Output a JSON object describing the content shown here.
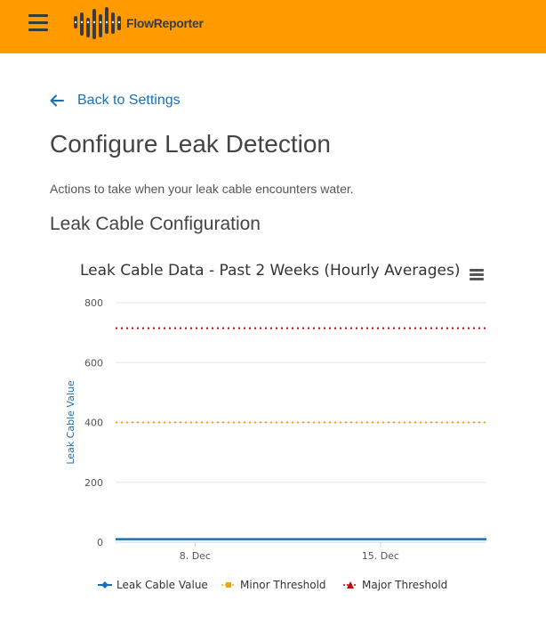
{
  "header": {
    "logo_brand": "Flow",
    "logo_brand_suffix": "Reporter",
    "colors": {
      "bar": "#ff9a00",
      "accent": "#1a6fb5"
    }
  },
  "back_link": {
    "label": "Back to Settings",
    "icon": "arrow-left-icon"
  },
  "page": {
    "title": "Configure Leak Detection",
    "description": "Actions to take when your leak cable encounters water.",
    "section_title": "Leak Cable Configuration"
  },
  "chart_data": {
    "type": "line",
    "title": "Leak Cable Data - Past 2 Weeks (Hourly Averages)",
    "ylabel": "Leak Cable Value",
    "xlabel": "",
    "ylim": [
      0,
      800
    ],
    "y_ticks": [
      "0",
      "200",
      "400",
      "600",
      "800"
    ],
    "x_ticks": [
      "8. Dec",
      "15. Dec"
    ],
    "x_range": [
      "2019-12-05",
      "2019-12-19"
    ],
    "legend_position": "bottom",
    "series": [
      {
        "name": "Leak Cable Value",
        "color": "#1a6fb5",
        "style": "solid",
        "x": [
          "2019-12-05",
          "2019-12-19"
        ],
        "values": [
          10,
          10
        ]
      },
      {
        "name": "Minor Threshold",
        "color": "#f0a800",
        "style": "dotted",
        "x": [
          "2019-12-05",
          "2019-12-19"
        ],
        "values": [
          400,
          400
        ]
      },
      {
        "name": "Major Threshold",
        "color": "#d00000",
        "style": "dotted",
        "x": [
          "2019-12-05",
          "2019-12-19"
        ],
        "values": [
          715,
          715
        ]
      }
    ]
  }
}
